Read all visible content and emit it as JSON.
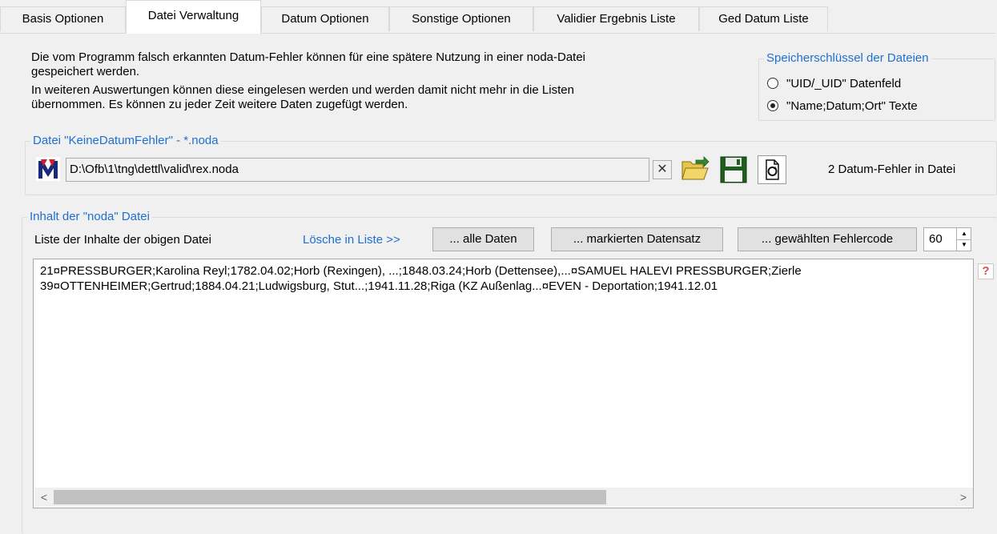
{
  "tabs": [
    {
      "label": "Basis Optionen"
    },
    {
      "label": "Datei Verwaltung"
    },
    {
      "label": "Datum Optionen"
    },
    {
      "label": "Sonstige Optionen"
    },
    {
      "label": "Validier Ergebnis Liste"
    },
    {
      "label": "Ged Datum Liste"
    }
  ],
  "description": {
    "line1": "Die vom Programm falsch erkannten Datum-Fehler können für eine spätere Nutzung in einer noda-Datei",
    "line2": "gespeichert werden.",
    "line3": "In weiteren Auswertungen können diese eingelesen werden und werden damit nicht mehr in die Listen",
    "line4": "übernommen. Es können zu jeder Zeit weitere Daten zugefügt werden."
  },
  "storage_key": {
    "legend": "Speicherschlüssel der Dateien",
    "options": [
      {
        "label": "\"UID/_UID\" Datenfeld",
        "checked": false
      },
      {
        "label": "\"Name;Datum;Ort\" Texte",
        "checked": true
      }
    ]
  },
  "file_group": {
    "legend": "Datei \"KeineDatumFehler\" - *.noda",
    "path": "D:\\Ofb\\1\\tng\\dettl\\valid\\rex.noda",
    "status": "2 Datum-Fehler in Datei",
    "logo_text": "M"
  },
  "content_group": {
    "legend": "Inhalt der \"noda\" Datei",
    "list_label": "Liste der Inhalte der obigen Datei",
    "delete_label": "Lösche in Liste >>",
    "btn_all": "... alle Daten",
    "btn_marked": "... markierten Datensatz",
    "btn_errorcode": "... gewählten Fehlercode",
    "errorcode_value": "60",
    "rows": [
      "21¤PRESSBURGER;Karolina Reyl;1782.04.02;Horb (Rexingen), ...;1848.03.24;Horb (Dettensee),...¤SAMUEL HALEVI PRESSBURGER;Zierle",
      "39¤OTTENHEIMER;Gertrud;1884.04.21;Ludwigsburg, Stut...;1941.11.28;Riga (KZ Außenlag...¤EVEN - Deportation;1941.12.01"
    ],
    "help_glyph": "?"
  },
  "colors": {
    "accent": "#1e6fd0",
    "folder": "#d8b22a",
    "save": "#1f5c1f"
  }
}
